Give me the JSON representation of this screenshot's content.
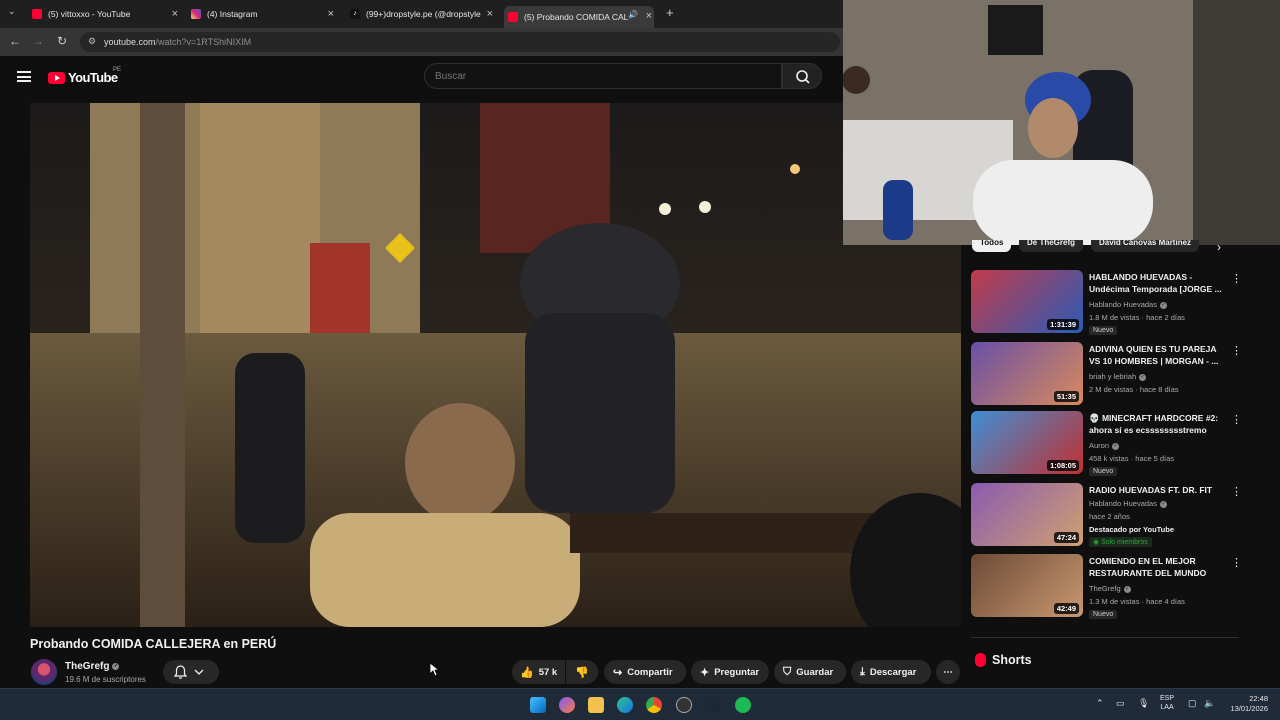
{
  "browser": {
    "tabs": [
      {
        "label": "(5) vittoxxo - YouTube",
        "color": "#ff0033"
      },
      {
        "label": "(4) Instagram",
        "color": "#d62976"
      },
      {
        "label": "(99+)dropstyle.pe (@dropstyle",
        "color": "#111111"
      },
      {
        "label": "(5) Probando COMIDA CAL",
        "color": "#ff0033"
      }
    ],
    "url_main": "youtube.com",
    "url_rest": "/watch?v=1RTShiNIXIM"
  },
  "youtube": {
    "logo_text": "YouTube",
    "country_code": "PE",
    "search_placeholder": "Buscar"
  },
  "video": {
    "title": "Probando COMIDA CALLEJERA en PERÚ",
    "channel": "TheGrefg",
    "subscribers": "19.6 M de suscriptores",
    "likes": "57 k",
    "share_label": "Compartir",
    "ask_label": "Preguntar",
    "save_label": "Guardar",
    "download_label": "Descargar"
  },
  "sidebar": {
    "chips": [
      "Todos",
      "De TheGrefg",
      "David Cánovas Martínez"
    ],
    "recommendations": [
      {
        "title": "HABLANDO HUEVADAS - Undécima Temporada [JORGE ...",
        "channel": "Hablando Huevadas",
        "meta": "1.8 M de vistas · hace 2 días",
        "duration": "1:31:39",
        "badge": "Nuevo",
        "thumb": "#c23b4a"
      },
      {
        "title": "ADIVINA QUIEN ES TU PAREJA VS 10 HOMBRES | MORGAN - ...",
        "channel": "briah y lebriah",
        "meta": "2 M de vistas · hace 8 días",
        "duration": "51:35",
        "badge": "",
        "thumb": "#6a4fa8"
      },
      {
        "title": "💀 MINECRAFT HARDCORE #2: ahora sí es ecsssssssstremo",
        "channel": "Auron",
        "meta": "458 k vistas · hace 5 días",
        "duration": "1:08:05",
        "badge": "Nuevo",
        "thumb": "#3d8fd6"
      },
      {
        "title": "RADIO HUEVADAS FT. DR. FIT",
        "channel": "Hablando Huevadas",
        "meta": "hace 2 años",
        "duration": "47:24",
        "badge": "",
        "featured": "Destacado por YouTube",
        "members": "Solo miembros",
        "thumb": "#8a5bb0"
      },
      {
        "title": "COMIENDO EN EL MEJOR RESTAURANTE DEL MUNDO",
        "channel": "TheGrefg",
        "meta": "1.3 M de vistas · hace 4 días",
        "duration": "42:49",
        "badge": "Nuevo",
        "thumb": "#6b4a36"
      }
    ],
    "shorts_label": "Shorts"
  },
  "taskbar": {
    "lang_line1": "ESP",
    "lang_line2": "LAA",
    "time": "22:48",
    "date": "13/01/2026"
  }
}
